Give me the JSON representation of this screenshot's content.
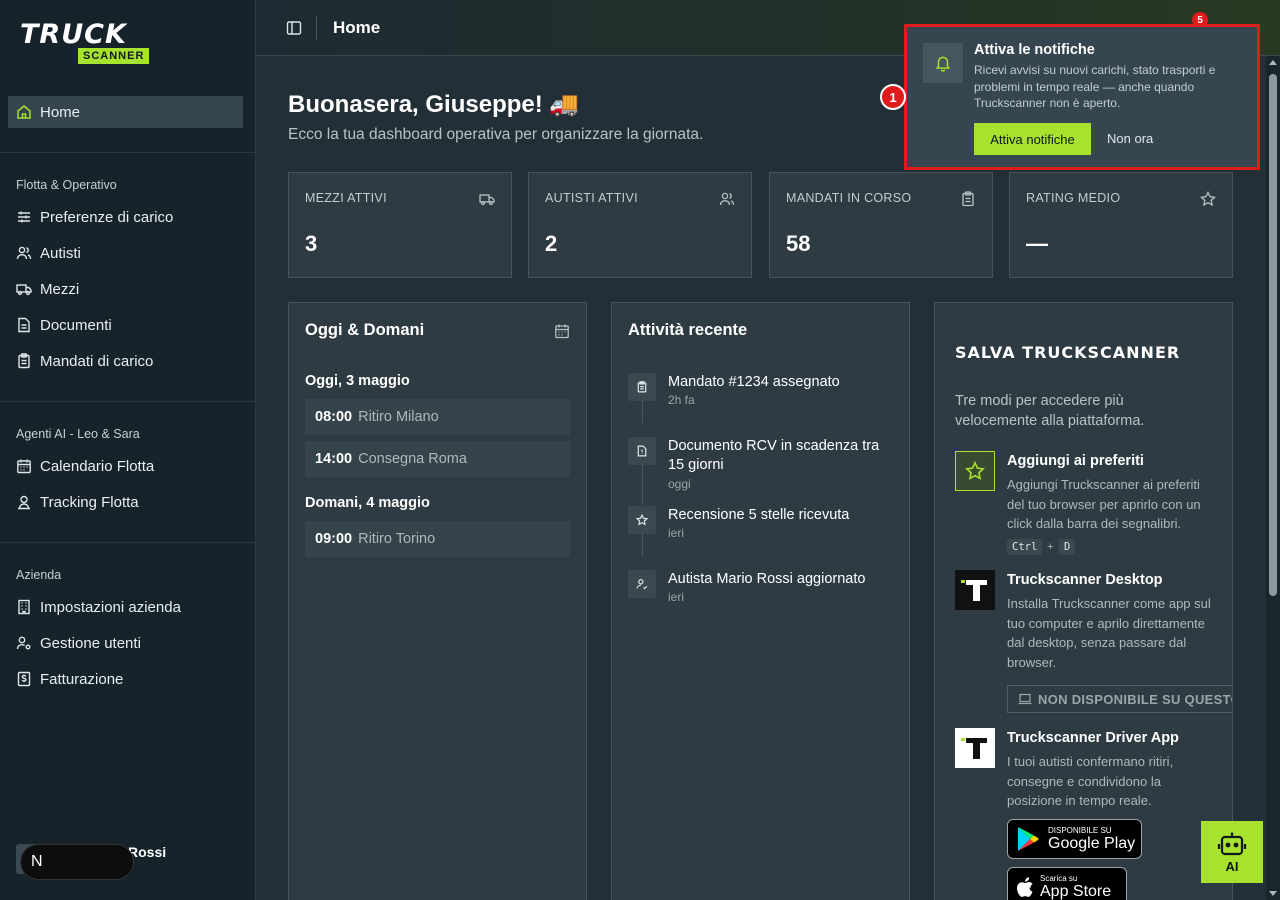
{
  "brand": {
    "logo_top": "TRUCK",
    "logo_bottom": "SCANNER"
  },
  "sidebar": {
    "home": "Home",
    "section_fleet": "Flotta & Operativo",
    "fleet_items": [
      "Preferenze di carico",
      "Autisti",
      "Mezzi",
      "Documenti",
      "Mandati di carico"
    ],
    "section_ai": "Agenti AI - Leo & Sara",
    "ai_items": [
      "Calendario Flotta",
      "Tracking Flotta"
    ],
    "section_company": "Azienda",
    "company_items": [
      "Impostazioni azienda",
      "Gestione utenti",
      "Fatturazione"
    ],
    "user_name": "Rossi",
    "next_label": "N"
  },
  "topbar": {
    "title": "Home",
    "notif_count": "5"
  },
  "main": {
    "greeting": "Buonasera, Giuseppe! 🚚",
    "subtitle": "Ecco la tua dashboard operativa per organizzare la giornata.",
    "stats": [
      {
        "label": "MEZZI ATTIVI",
        "value": "3"
      },
      {
        "label": "AUTISTI ATTIVI",
        "value": "2"
      },
      {
        "label": "MANDATI IN CORSO",
        "value": "58"
      },
      {
        "label": "RATING MEDIO",
        "value": "—"
      }
    ],
    "schedule": {
      "title": "Oggi & Domani",
      "today": "Oggi, 3 maggio",
      "today_slots": [
        {
          "time": "08:00",
          "desc": "Ritiro Milano"
        },
        {
          "time": "14:00",
          "desc": "Consegna Roma"
        }
      ],
      "tomorrow": "Domani, 4 maggio",
      "tomorrow_slots": [
        {
          "time": "09:00",
          "desc": "Ritiro Torino"
        }
      ]
    },
    "activity": {
      "title": "Attività recente",
      "items": [
        {
          "title": "Mandato #1234 assegnato",
          "time": "2h fa"
        },
        {
          "title": "Documento RCV in scadenza tra 15 giorni",
          "time": "oggi"
        },
        {
          "title": "Recensione 5 stelle ricevuta",
          "time": "ieri"
        },
        {
          "title": "Autista Mario Rossi aggiornato",
          "time": "ieri"
        }
      ]
    },
    "save": {
      "title": "SALVA TRUCKSCANNER",
      "subtitle": "Tre modi per accedere più velocemente alla piattaforma.",
      "fav_title": "Aggiungi ai preferiti",
      "fav_desc": "Aggiungi Truckscanner ai preferiti del tuo browser per aprirlo con un click dalla barra dei segnalibri.",
      "kbd_ctrl": "Ctrl",
      "kbd_plus": "+",
      "kbd_d": "D",
      "desktop_title": "Truckscanner Desktop",
      "desktop_desc": "Installa Truckscanner come app sul tuo computer e aprilo direttamente dal desktop, senza passare dal browser.",
      "desktop_btn": "NON DISPONIBILE SU QUESTO",
      "driver_title": "Truckscanner Driver App",
      "driver_desc": "I tuoi autisti confermano ritiri, consegne e condividono la posizione in tempo reale.",
      "gplay_small": "DISPONIBILE SU",
      "gplay_large": "Google Play",
      "appstore_small": "Scarica su",
      "appstore_large": "App Store"
    }
  },
  "notification": {
    "title": "Attiva le notifiche",
    "desc": "Ricevi avvisi su nuovi carichi, stato trasporti e problemi in tempo reale — anche quando Truckscanner non è aperto.",
    "primary": "Attiva notifiche",
    "secondary": "Non ora",
    "step": "1"
  },
  "ai_button": {
    "label": "AI"
  },
  "colors": {
    "accent": "#a6e22e",
    "alert": "#e01b1b",
    "bg": "#222f36",
    "card": "#2e3b42"
  }
}
